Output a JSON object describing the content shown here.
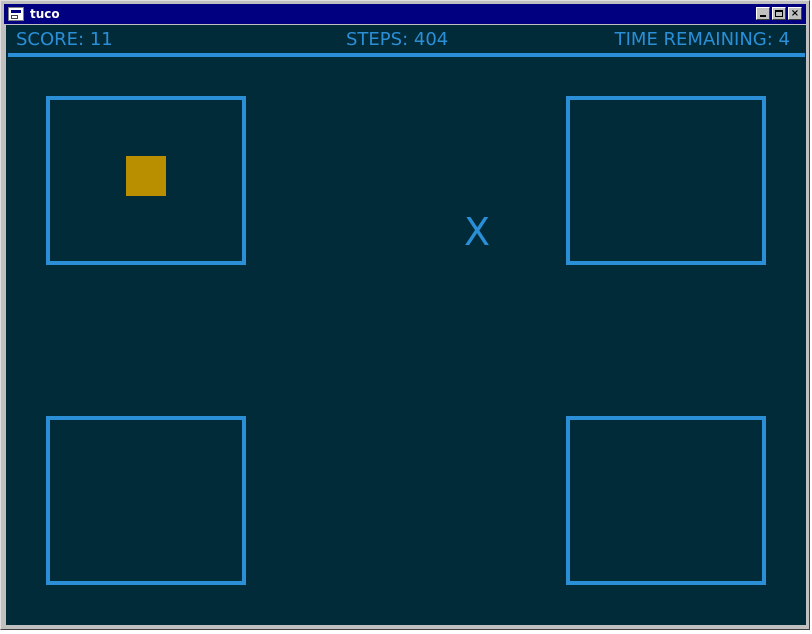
{
  "window": {
    "title": "tuco",
    "controls": {
      "minimize": "minimize",
      "maximize": "maximize",
      "close": "×"
    }
  },
  "hud": {
    "score_label": "SCORE: 11",
    "steps_label": "STEPS: 404",
    "time_label": "TIME REMAINING: 4"
  },
  "game": {
    "fixation": "X",
    "boxes": [
      "top-left",
      "top-right",
      "bottom-left",
      "bottom-right"
    ],
    "target_box": "top-left",
    "colors": {
      "background": "#022b3a",
      "accent": "#2a8fd7",
      "target": "#b98f00"
    }
  }
}
